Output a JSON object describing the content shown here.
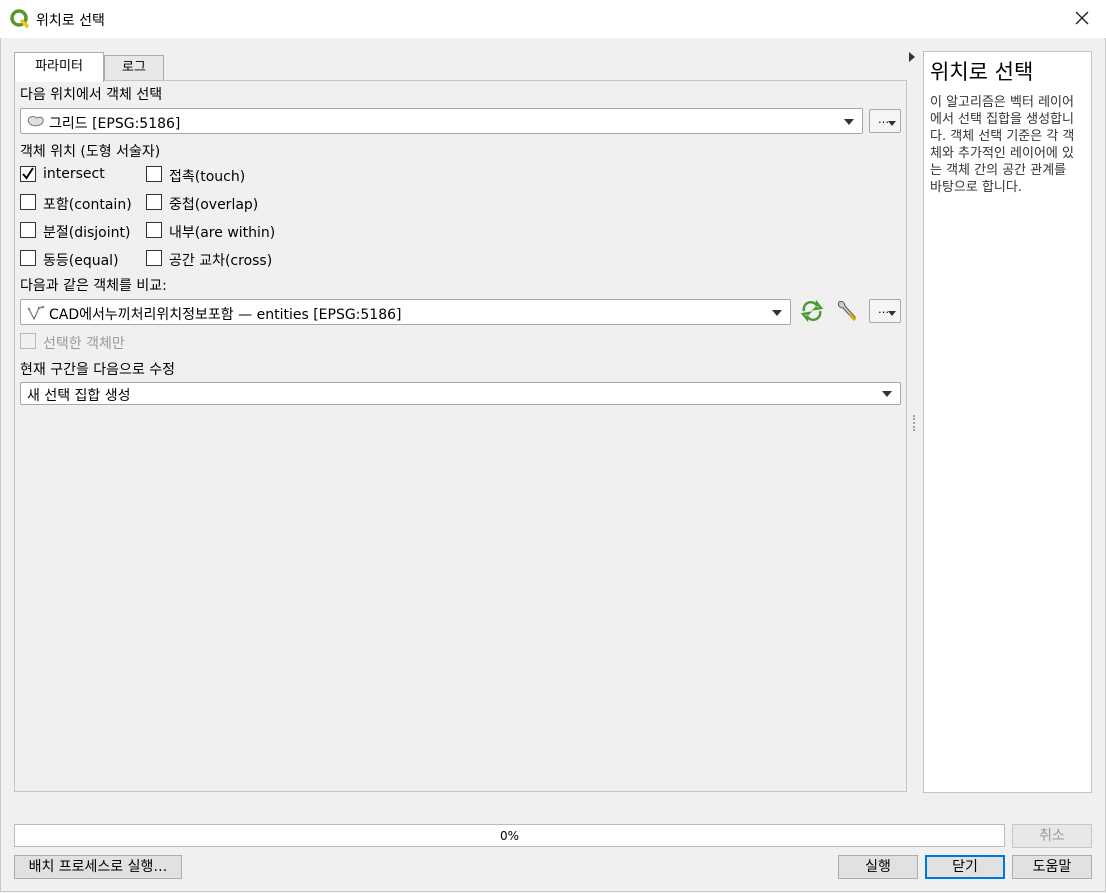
{
  "window": {
    "title": "위치로 선택"
  },
  "tabs": [
    {
      "label": "파라미터",
      "active": true
    },
    {
      "label": "로그",
      "active": false
    }
  ],
  "params": {
    "select_from_label": "다음 위치에서 객체 선택",
    "select_layer": "그리드 [EPSG:5186]",
    "predicate_label": "객체 위치 (도형 서술자)",
    "predicates": [
      {
        "label": "intersect",
        "checked": true
      },
      {
        "label": "접촉(touch)",
        "checked": false
      },
      {
        "label": "포함(contain)",
        "checked": false
      },
      {
        "label": "중첩(overlap)",
        "checked": false
      },
      {
        "label": "분절(disjoint)",
        "checked": false
      },
      {
        "label": "내부(are within)",
        "checked": false
      },
      {
        "label": "동등(equal)",
        "checked": false
      },
      {
        "label": "공간 교차(cross)",
        "checked": false
      }
    ],
    "compare_label": "다음과 같은 객체를 비교:",
    "compare_layer": "CAD에서누끼처리위치정보포함 — entities [EPSG:5186]",
    "selected_only_label": "선택한 객체만",
    "modify_label": "현재 구간을 다음으로 수정",
    "modify_value": "새 선택 집합 생성",
    "dots": "…"
  },
  "help": {
    "title": "위치로 선택",
    "body": "이 알고리즘은 벡터 레이어에서 선택 집합을 생성합니다. 객체 선택 기준은 각 객체와 추가적인 레이어에 있는 객체 간의 공간 관계를 바탕으로 합니다."
  },
  "progress": {
    "text": "0%",
    "value": 0
  },
  "buttons": {
    "cancel": "취소",
    "batch": "배치 프로세스로 실행…",
    "run": "실행",
    "close": "닫기",
    "help": "도움말"
  },
  "colors": {
    "accent": "#0078d7",
    "qgis_green": "#589632",
    "qgis_yellow": "#f0c419"
  }
}
